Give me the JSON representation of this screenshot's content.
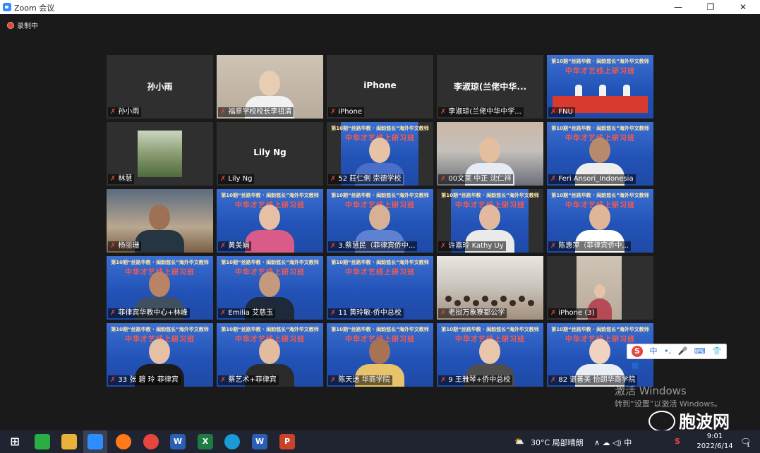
{
  "window": {
    "title": "Zoom 会议",
    "minimize": "—",
    "maximize": "❐",
    "close": "✕"
  },
  "recording": "录制中",
  "mute_glyph": "✗",
  "tiles": [
    {
      "id": "sun",
      "center": "孙小雨",
      "label": "孙小雨"
    },
    {
      "id": "principal",
      "center": "",
      "label": "福原学校校长李祖清"
    },
    {
      "id": "iphone1",
      "center": "iPhone",
      "label": "iPhone"
    },
    {
      "id": "li",
      "center": "李淑琼(兰佬中华...",
      "label": "李淑琼(兰佬中华中学..."
    },
    {
      "id": "fnu",
      "center": "",
      "label": "FNU"
    },
    {
      "id": "lin",
      "center": "",
      "label": "林慧"
    },
    {
      "id": "lilyng",
      "center": "Lily Ng",
      "label": "Lily Ng"
    },
    {
      "id": "zhuang",
      "center": "",
      "label": "52 莊仁俐 崇德学校"
    },
    {
      "id": "shen",
      "center": "",
      "label": "00文莱 中正 沈仁祥"
    },
    {
      "id": "feri",
      "center": "",
      "label": "Feri Ansori_Indonesia"
    },
    {
      "id": "yang",
      "center": "",
      "label": "杨丽珊"
    },
    {
      "id": "huang",
      "center": "",
      "label": "黃美娟"
    },
    {
      "id": "cai",
      "center": "",
      "label": "3.蔡慧民（菲律宾侨中..."
    },
    {
      "id": "xu",
      "center": "",
      "label": "许嘉玲 Kathy Uy"
    },
    {
      "id": "chen",
      "center": "",
      "label": "陈惠萍（菲律宾侨中..."
    },
    {
      "id": "linfeng",
      "center": "",
      "label": "菲律宾华教中心+林峰"
    },
    {
      "id": "emilia",
      "center": "",
      "label": "Emilia 艾慈玉"
    },
    {
      "id": "huangling",
      "center": "",
      "label": "11 黄玲敏-侨中总校"
    },
    {
      "id": "laos",
      "center": "",
      "label": "老挝万象寮都公学"
    },
    {
      "id": "iphone3",
      "center": "",
      "label": "iPhone (3)"
    },
    {
      "id": "zhang",
      "center": "",
      "label": "33 张 碧 玲 菲律宾"
    },
    {
      "id": "caiyi",
      "center": "",
      "label": "蔡艺术+菲律宾"
    },
    {
      "id": "chentian",
      "center": "",
      "label": "陈天送 华商学院"
    },
    {
      "id": "wang",
      "center": "",
      "label": "9 王雅琴+侨中总校"
    },
    {
      "id": "zhan",
      "center": "",
      "label": "82 谌善美 怡朗华商学院"
    }
  ],
  "banner": {
    "top": "第10期“丝路华教 · 闽韵悠长”海外华文教师",
    "main": "中华才艺线上研习班"
  },
  "ime": {
    "logo": "S",
    "items": [
      "中",
      "•,",
      "🎤",
      "⌨",
      "👕",
      "▦"
    ]
  },
  "activation": {
    "line1": "激活 Windows",
    "line2": "转到“设置”以激活 Windows。"
  },
  "watermark": "胞波网",
  "taskbar": {
    "weather": "30°C  局部晴朗",
    "tray": "∧  ☁  ◁)  中",
    "time": "9:01",
    "date": "2022/6/14",
    "notify_count": "1"
  },
  "colors": {
    "active_border": "#c6e44a",
    "mute": "#e0463a",
    "zoom_blue": "#2d8cff"
  }
}
